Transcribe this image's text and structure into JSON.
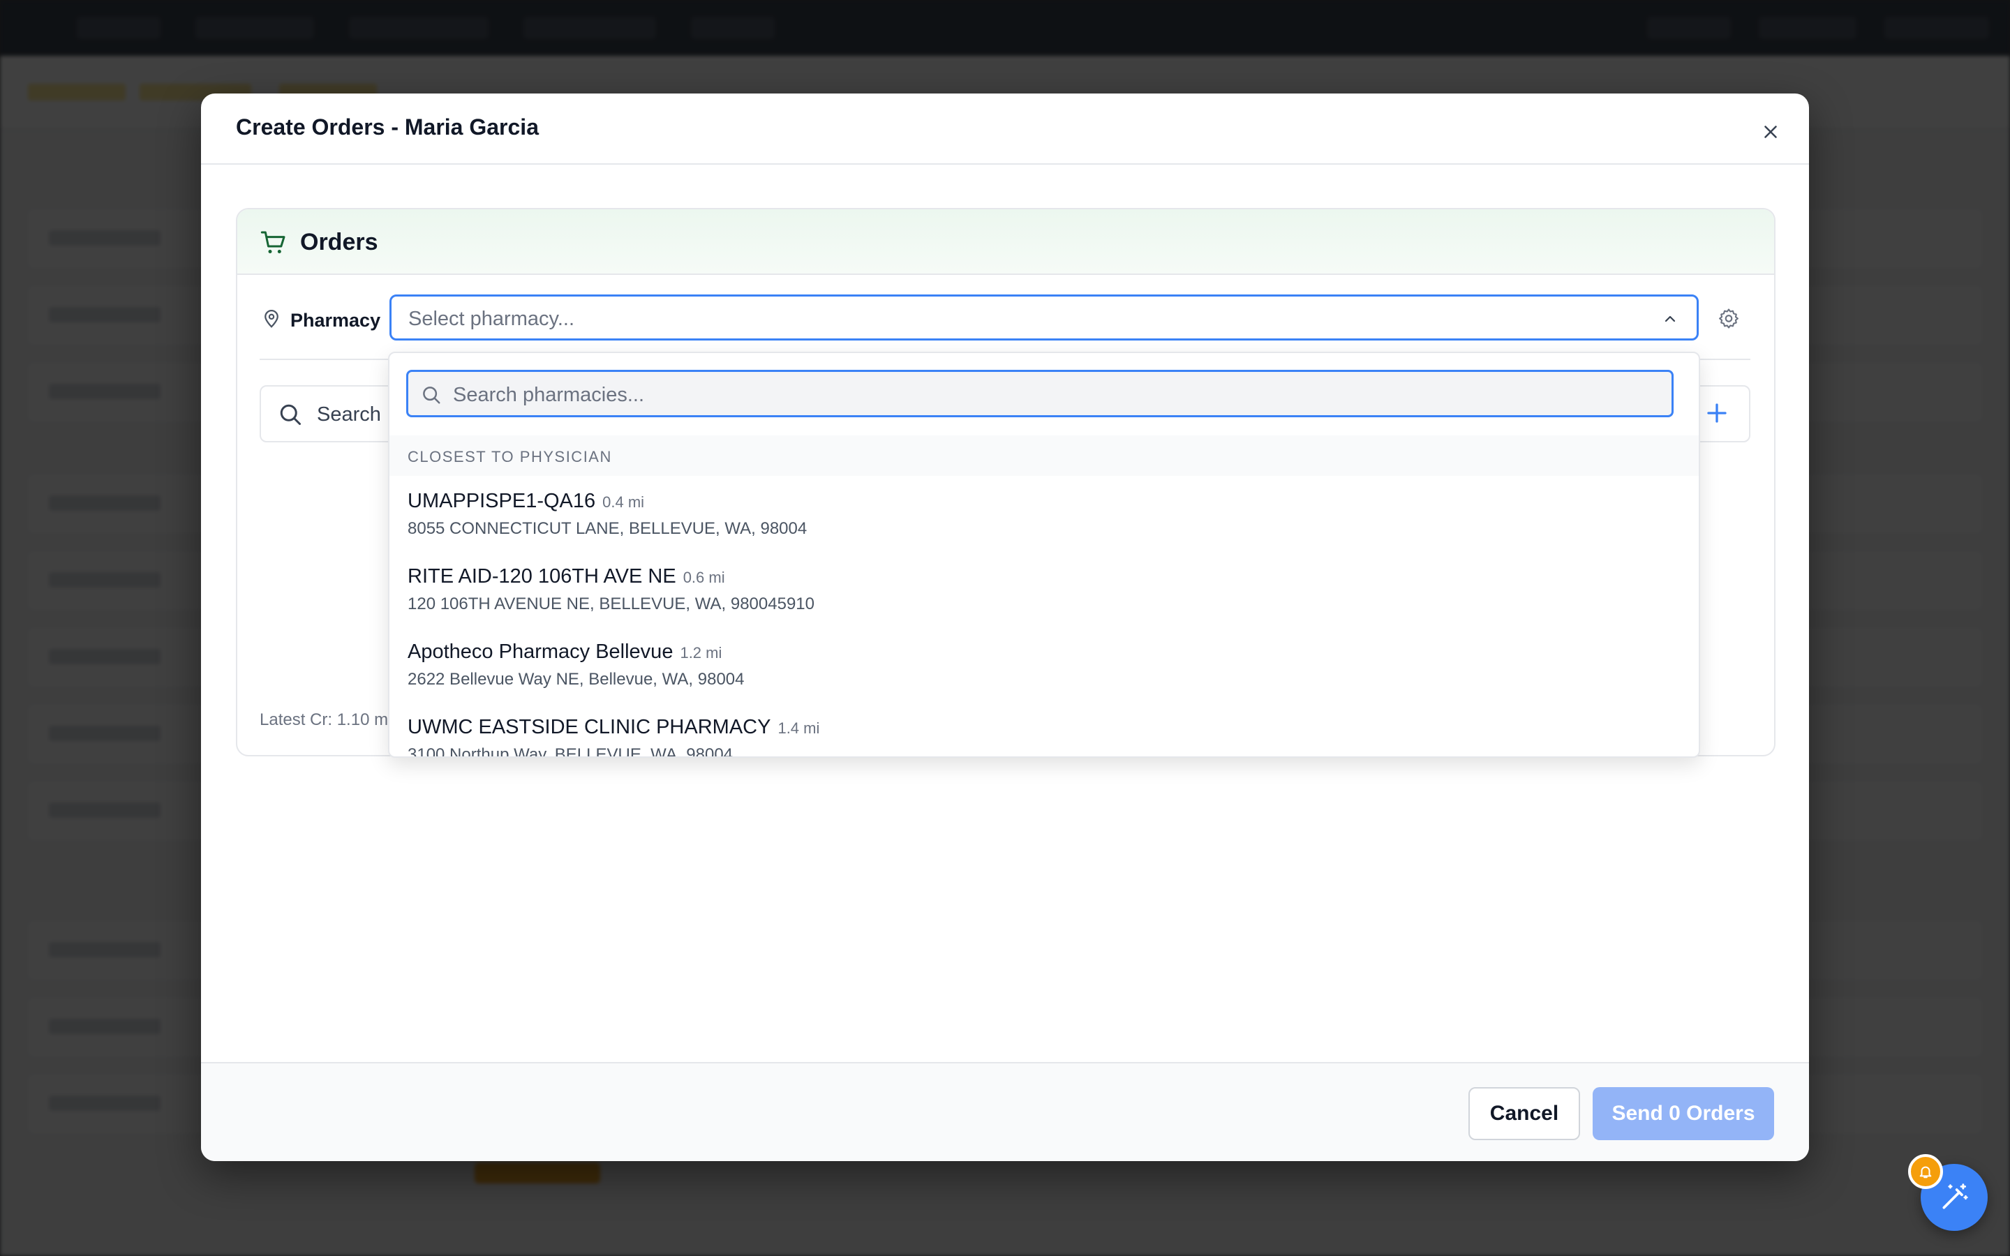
{
  "modal": {
    "title": "Create Orders - Maria Garcia"
  },
  "orders_card": {
    "title": "Orders",
    "pharmacy_label": "Pharmacy",
    "pharmacy_select_placeholder": "Select pharmacy...",
    "search_text": "Search",
    "latest_cr": "Latest Cr: 1.10 m"
  },
  "dropdown": {
    "search_placeholder": "Search pharmacies...",
    "section_label": "CLOSEST TO PHYSICIAN",
    "items": [
      {
        "name": "UMAPPISPE1-QA16",
        "distance": "0.4 mi",
        "address": "8055 CONNECTICUT LANE, BELLEVUE, WA, 98004"
      },
      {
        "name": "RITE AID-120 106TH AVE NE",
        "distance": "0.6 mi",
        "address": "120 106TH AVENUE NE, BELLEVUE, WA, 980045910"
      },
      {
        "name": "Apotheco Pharmacy Bellevue",
        "distance": "1.2 mi",
        "address": "2622 Bellevue Way NE, Bellevue, WA, 98004"
      },
      {
        "name": "UWMC EASTSIDE CLINIC PHARMACY",
        "distance": "1.4 mi",
        "address": "3100 Northup Way, BELLEVUE, WA, 98004"
      }
    ]
  },
  "footer": {
    "cancel_label": "Cancel",
    "send_label": "Send 0 Orders"
  },
  "icons": {
    "close": "close-icon",
    "cart": "shopping-cart-icon",
    "pin": "map-pin-icon",
    "chevron": "chevron-up-icon",
    "gear": "gear-icon",
    "search": "search-icon",
    "plus": "plus-icon",
    "assistant": "magic-wand-icon",
    "bell": "bell-icon"
  },
  "colors": {
    "accent": "#3b82f6",
    "send_disabled": "#93b4f7",
    "cart_green": "#166534",
    "notification": "#f59e0b"
  }
}
